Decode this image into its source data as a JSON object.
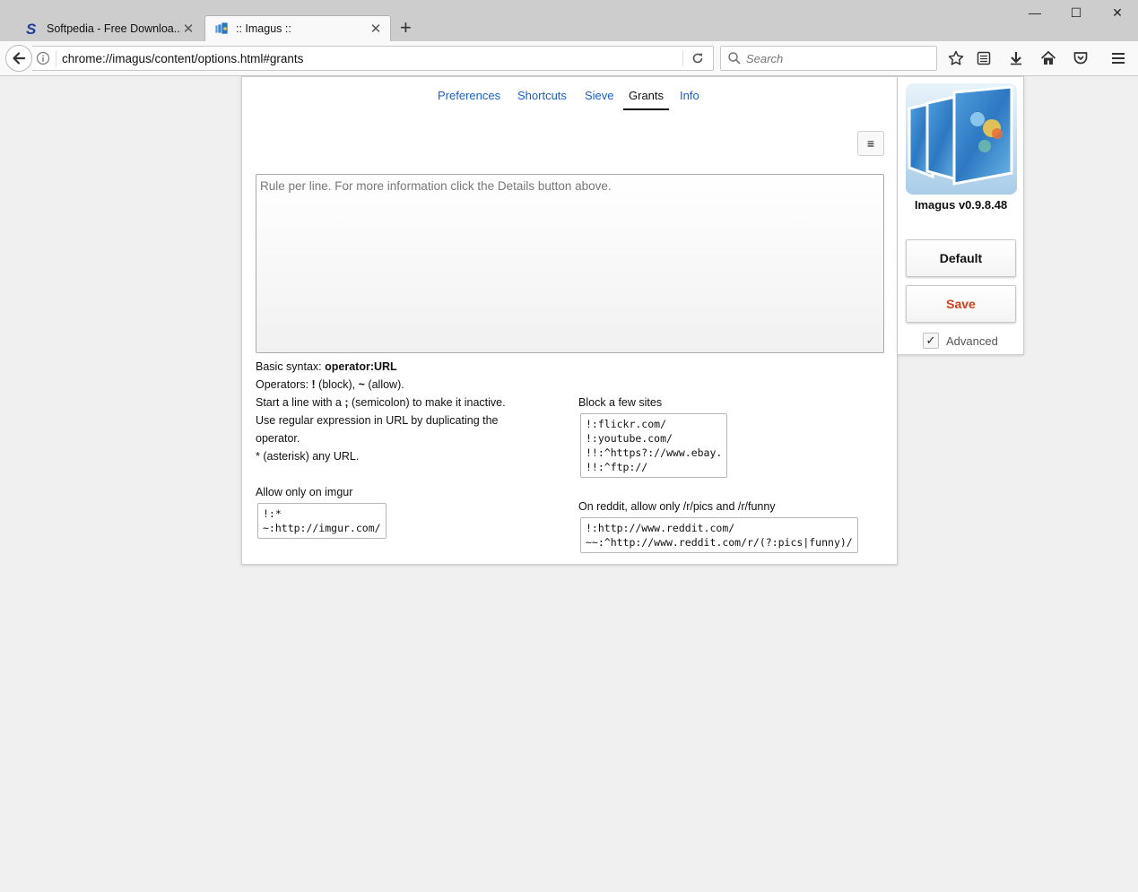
{
  "browser": {
    "tabs": [
      {
        "title": "Softpedia - Free Downloa...",
        "close": "✕"
      },
      {
        "title": ":: Imagus ::",
        "close": "✕"
      }
    ],
    "new_tab": "+",
    "window_controls": {
      "minimize": "—",
      "maximize": "☐",
      "close": "✕"
    },
    "url": "chrome://imagus/content/options.html#grants",
    "search_placeholder": "Search"
  },
  "nav_tabs": [
    "Preferences",
    "Shortcuts",
    "Sieve",
    "Grants",
    "Info"
  ],
  "active_tab": "Grants",
  "menu_button": "≡",
  "grants": {
    "placeholder": "Rule per line. For more information click the Details button above.",
    "value": ""
  },
  "help": {
    "syntax_prefix": "Basic syntax: ",
    "syntax_bold": "operator:URL",
    "operators_prefix": "Operators: ",
    "op_block_symbol": "!",
    "op_block_text": " (block), ",
    "op_allow_symbol": "~",
    "op_allow_text": " (allow).",
    "line3_a": "Start a line with a ",
    "line3_sym": ";",
    "line3_b": " (semicolon) to make it inactive.",
    "line4": "Use regular expression in URL by duplicating the",
    "line5": "operator.",
    "line6": "* (asterisk) any URL."
  },
  "examples": [
    {
      "title": "Allow only on imgur",
      "code": "!:*\n~:http://imgur.com/"
    },
    {
      "title": "Block a few sites",
      "code": "!:flickr.com/\n!:youtube.com/\n!!:^https?://www.ebay.\n!!:^ftp://"
    },
    {
      "title": "On reddit, allow only /r/pics and /r/funny",
      "code": "!:http://www.reddit.com/\n~~:^http://www.reddit.com/r/(?:pics|funny)/"
    }
  ],
  "sidebar": {
    "version": "Imagus v0.9.8.48",
    "default_label": "Default",
    "save_label": "Save",
    "advanced_label": "Advanced",
    "advanced_checked": true,
    "check_mark": "✓"
  },
  "colors": {
    "link": "#1a5fc8",
    "save": "#d0401a",
    "page_bg": "#f0f0f0",
    "tabstrip_bg": "#cdcdcd"
  }
}
